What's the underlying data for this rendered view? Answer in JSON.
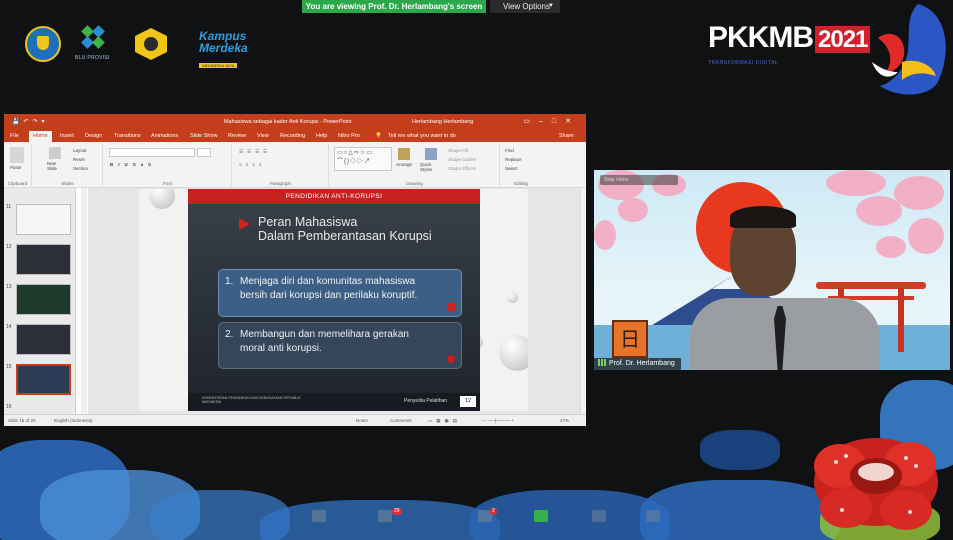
{
  "zoom": {
    "share_banner": "You are viewing Prof. Dr. Herlambang's screen",
    "view_options": "View Options"
  },
  "logos": {
    "blu_label": "BLU PROVISI",
    "kampus_line1": "Kampus",
    "kampus_line2": "Merdeka",
    "kampus_tag": "INDONESIA JAYA"
  },
  "event": {
    "pkkmb": "PKKMB",
    "year": "2021",
    "subtitle": "TRANSFORMASI DIGITAL"
  },
  "powerpoint": {
    "document_title": "Mahasiswa sebagai kader Anti Korupsi - PowerPoint",
    "user_name": "Herlambang Herlambang",
    "tabs": [
      "File",
      "Home",
      "Insert",
      "Design",
      "Transitions",
      "Animations",
      "Slide Show",
      "Review",
      "View",
      "Recording",
      "Help",
      "Nitro Pro"
    ],
    "tell_me": "Tell me what you want to do",
    "share": "Share",
    "ribbon": {
      "clipboard": "Clipboard",
      "slides": "Slides",
      "font": "Font",
      "paragraph": "Paragraph",
      "drawing": "Drawing",
      "editing": "Editing",
      "paste": "Paste",
      "new_slide": "New Slide",
      "layout": "Layout",
      "reset": "Reset",
      "section": "Section",
      "arrange": "Arrange",
      "quick_styles": "Quick Styles",
      "shape_fill": "Shape Fill",
      "shape_outline": "Shape Outline",
      "shape_effects": "Shape Effects",
      "find": "Find",
      "replace": "Replace",
      "select": "Select"
    },
    "thumbnails": [
      {
        "num": "11"
      },
      {
        "num": "12"
      },
      {
        "num": "13"
      },
      {
        "num": "14"
      },
      {
        "num": "15"
      },
      {
        "num": "16"
      }
    ],
    "slide": {
      "header": "PENDIDIKAN ANTI-KORUPSI",
      "title_line1": "Peran Mahasiswa",
      "title_line2": "Dalam Pemberantasan Korupsi",
      "point1_num": "1.",
      "point1_line1": "Menjaga diri dan komunitas mahasiswa",
      "point1_line2": "bersih dari korupsi dan perilaku koruptif.",
      "point2_num": "2.",
      "point2_line1": "Membangun dan memelihara gerakan",
      "point2_line2": "moral anti korupsi.",
      "footer_left": "KEMENTERIAN PENDIDIKAN DAN KEBUDAYAAN REPUBLIK INDONESIA",
      "footer_right": "Penyedia Pelatihan",
      "page_number": "12"
    },
    "status": {
      "slide_of": "Slide 15 of 20",
      "language": "English (Indonesia)",
      "notes": "Notes",
      "comments": "Comments",
      "zoom": "47%"
    }
  },
  "webcam": {
    "participant_name": "Prof. Dr. Herlambang",
    "top_button": "Stop Video",
    "kanji": "日"
  },
  "toolbar": {
    "chat_badge": "29",
    "reactions_badge": "2"
  },
  "colors": {
    "ppt_red": "#c43e1c",
    "zoom_green": "#2aa84a",
    "slide_header_red": "#c8201f"
  }
}
